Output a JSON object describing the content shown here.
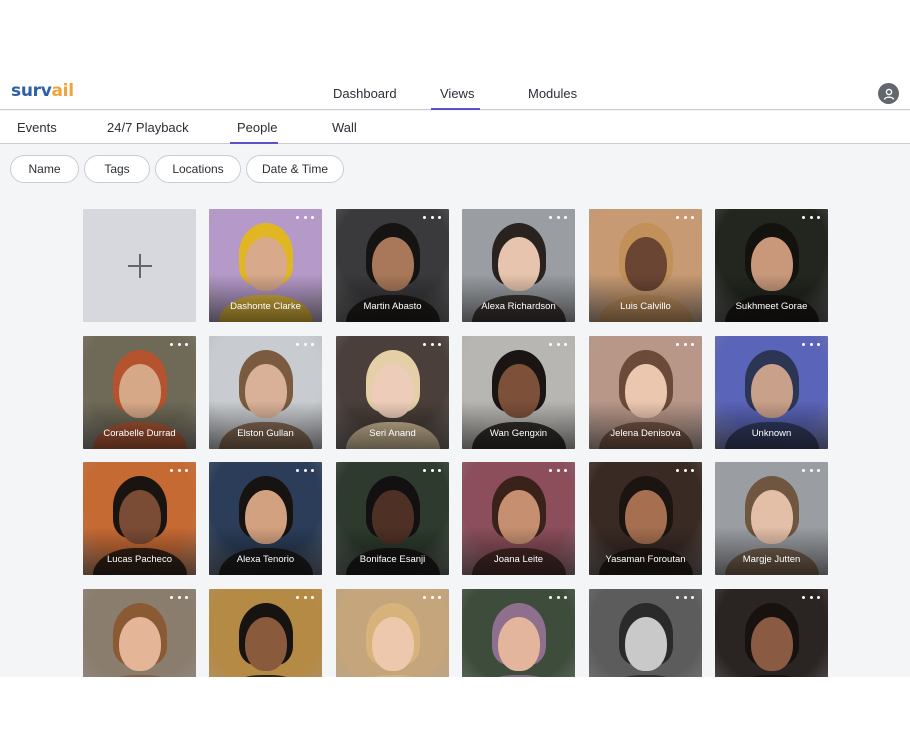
{
  "brand": {
    "part1": "surv",
    "part2": "ail",
    "color1": "#2f5fa8",
    "color2": "#f0a33a"
  },
  "nav": {
    "items": [
      {
        "label": "Dashboard",
        "active": false
      },
      {
        "label": "Views",
        "active": true
      },
      {
        "label": "Modules",
        "active": false
      }
    ],
    "accent": "#5b52c7"
  },
  "user_icon": "user-icon",
  "subnav": {
    "items": [
      {
        "label": "Events",
        "active": false
      },
      {
        "label": "24/7 Playback",
        "active": false
      },
      {
        "label": "People",
        "active": true
      },
      {
        "label": "Wall",
        "active": false
      }
    ]
  },
  "filters": [
    "Name",
    "Tags",
    "Locations",
    "Date & Time"
  ],
  "add_tile_icon": "plus-icon",
  "menu_icon": "more-dots-icon",
  "people": [
    {
      "name": "Dashonte Clarke",
      "bg": "#b59ac9",
      "skin": "#d8a98a",
      "hair": "#e0b723"
    },
    {
      "name": "Martin Abasto",
      "bg": "#3a3a3c",
      "skin": "#a9785a",
      "hair": "#161412"
    },
    {
      "name": "Alexa Richardson",
      "bg": "#9a9ea3",
      "skin": "#e7c4ad",
      "hair": "#2a221f"
    },
    {
      "name": "Luis Calvillo",
      "bg": "#c79a73",
      "skin": "#6b4533",
      "hair": "#c2915a"
    },
    {
      "name": "Sukhmeet Gorae",
      "bg": "#23261f",
      "skin": "#c9987b",
      "hair": "#14120f"
    },
    {
      "name": "Corabelle Durrad",
      "bg": "#6f6a57",
      "skin": "#d7a888",
      "hair": "#b5532f"
    },
    {
      "name": "Elston Gullan",
      "bg": "#c8cbcf",
      "skin": "#d9b198",
      "hair": "#7a5b3f"
    },
    {
      "name": "Seri Anand",
      "bg": "#4a3f3a",
      "skin": "#edcdb9",
      "hair": "#e4cfa6"
    },
    {
      "name": "Wan Gengxin",
      "bg": "#b8b6b2",
      "skin": "#7d5039",
      "hair": "#1a1512"
    },
    {
      "name": "Jelena Denisova",
      "bg": "#b89789",
      "skin": "#ebc7b0",
      "hair": "#6b4a39"
    },
    {
      "name": "Unknown",
      "bg": "#5a64b8",
      "skin": "#c9a08a",
      "hair": "#2c3554"
    },
    {
      "name": "Lucas Pacheco",
      "bg": "#c66a34",
      "skin": "#7b4c35",
      "hair": "#1a1410"
    },
    {
      "name": "Alexa Tenorio",
      "bg": "#2b3d59",
      "skin": "#d2a17f",
      "hair": "#161311"
    },
    {
      "name": "Boniface Esanji",
      "bg": "#2d3a2d",
      "skin": "#4e3024",
      "hair": "#121010"
    },
    {
      "name": "Joana Leite",
      "bg": "#8b4e5a",
      "skin": "#c58f70",
      "hair": "#3a221b"
    },
    {
      "name": "Yasaman Foroutan",
      "bg": "#3a2a24",
      "skin": "#a56f50",
      "hair": "#1b1411"
    },
    {
      "name": "Margje Jutten",
      "bg": "#9a9ea3",
      "skin": "#e3bfa7",
      "hair": "#6e5640"
    },
    {
      "name": "",
      "bg": "#8a7d6e",
      "skin": "#e4b596",
      "hair": "#8a5a34"
    },
    {
      "name": "",
      "bg": "#b58a45",
      "skin": "#8a5a3c",
      "hair": "#171311"
    },
    {
      "name": "",
      "bg": "#c4a57c",
      "skin": "#edc8ad",
      "hair": "#d7b27a"
    },
    {
      "name": "",
      "bg": "#3e4d3b",
      "skin": "#e3b59c",
      "hair": "#8e6f8e"
    },
    {
      "name": "",
      "bg": "#5c5c5c",
      "skin": "#c9c9c9",
      "hair": "#2a2a2a"
    },
    {
      "name": "",
      "bg": "#2a2422",
      "skin": "#8a5a42",
      "hair": "#171210"
    }
  ]
}
